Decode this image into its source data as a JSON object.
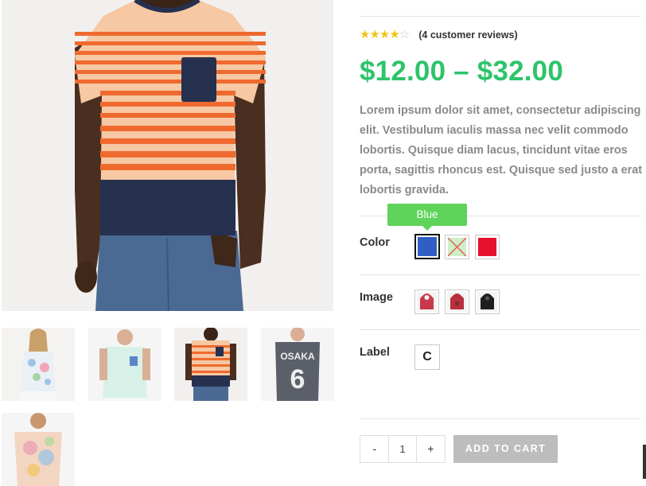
{
  "gallery": {
    "main_image": "striped-tshirt-model",
    "thumbnails": [
      "floral-top-model",
      "mint-pocket-tee-model",
      "striped-tshirt-model",
      "osaka-6-tee-model",
      "tie-dye-tee-model"
    ]
  },
  "product": {
    "rating_value": 4,
    "rating_max": 5,
    "review_text": "(4 customer reviews)",
    "price": "$12.00 – $32.00",
    "description": "Lorem ipsum dolor sit amet, consectetur adipiscing elit. Vestibulum iaculis massa nec velit commodo lobortis. Quisque diam lacus, tincidunt vitae eros porta, sagittis rhoncus est. Quisque sed justo a erat lobortis gravida."
  },
  "attributes": {
    "color": {
      "label": "Color",
      "tooltip": "Blue",
      "options": [
        {
          "name": "Blue",
          "hex": "#2f5fc4",
          "state": "selected"
        },
        {
          "name": "Green",
          "hex": "#cdeec8",
          "state": "unavailable"
        },
        {
          "name": "Red",
          "hex": "#e8112d",
          "state": "available"
        }
      ]
    },
    "image": {
      "label": "Image",
      "options": [
        "red-hoodie",
        "red-hoodie-alt",
        "black-hoodie"
      ]
    },
    "label": {
      "label": "Label",
      "options": [
        "C"
      ]
    }
  },
  "cart": {
    "minus": "-",
    "quantity": "1",
    "plus": "+",
    "add_to_cart": "ADD TO CART"
  },
  "colors": {
    "price": "#2ec46a",
    "tooltip": "#5fd35a",
    "star": "#f0c419",
    "button": "#bdbdbd"
  }
}
